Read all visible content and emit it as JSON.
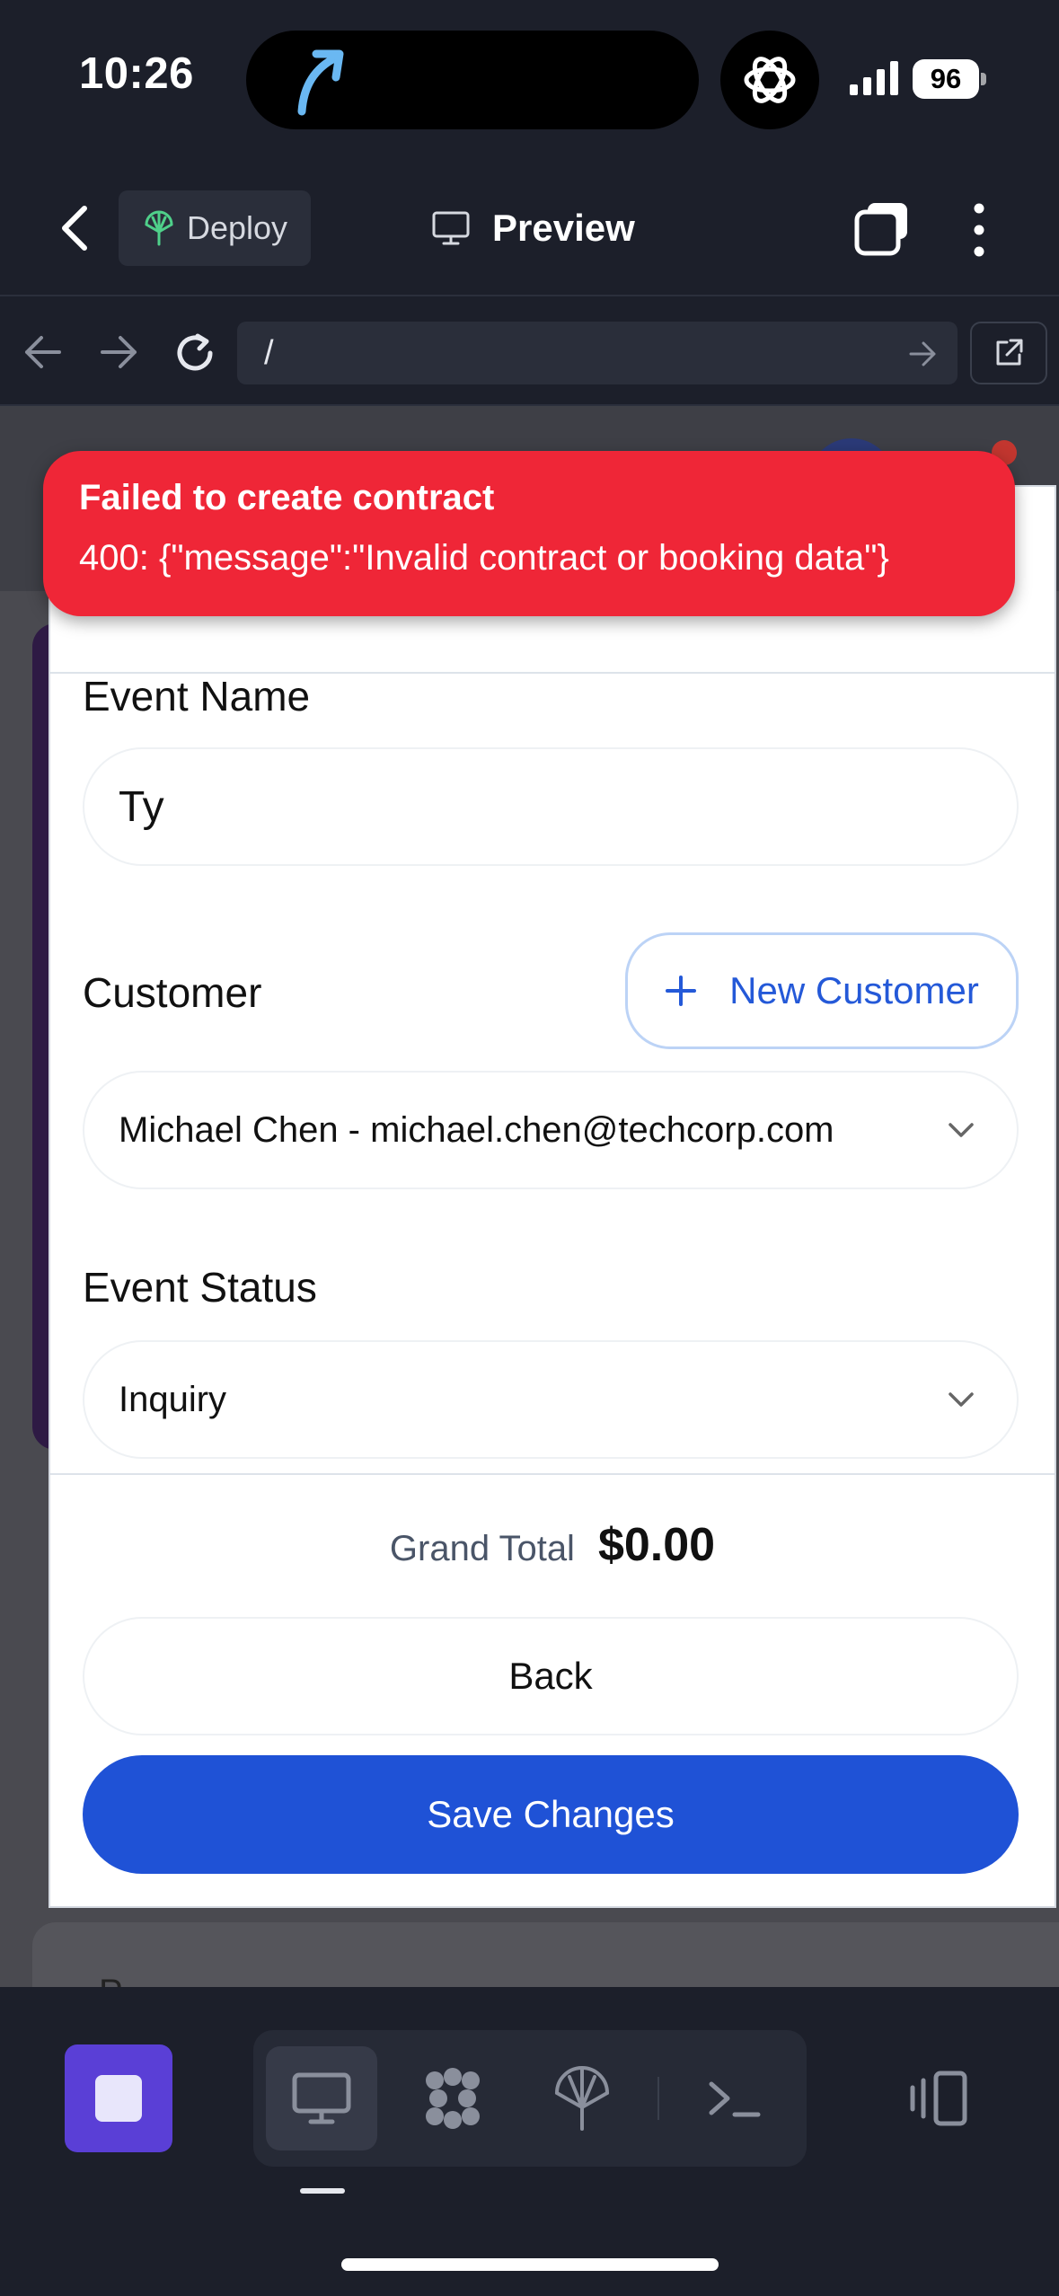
{
  "status_bar": {
    "time": "10:26",
    "battery": "96"
  },
  "header": {
    "deploy_label": "Deploy",
    "preview_label": "Preview"
  },
  "url_bar": {
    "url": "/"
  },
  "toast": {
    "title": "Failed to create contract",
    "message": "400: {\"message\":\"Invalid contract or booking data\"}",
    "color": "#ef2637"
  },
  "form": {
    "event_name_label": "Event Name",
    "event_name_value": "Ty",
    "customer_label": "Customer",
    "new_customer_label": "New Customer",
    "customer_value": "Michael Chen - michael.chen@techcorp.com",
    "event_status_label": "Event Status",
    "event_status_value": "Inquiry",
    "grand_total_label": "Grand Total",
    "grand_total_value": "$0.00",
    "back_label": "Back",
    "save_label": "Save Changes",
    "accent_color": "#1f52d6"
  },
  "bottom_bar": {
    "tools": [
      "desktop-icon",
      "workflow-icon",
      "deploy-icon",
      "terminal-icon"
    ],
    "active_tool": "desktop-icon"
  },
  "background": {
    "partial_text": "P"
  }
}
